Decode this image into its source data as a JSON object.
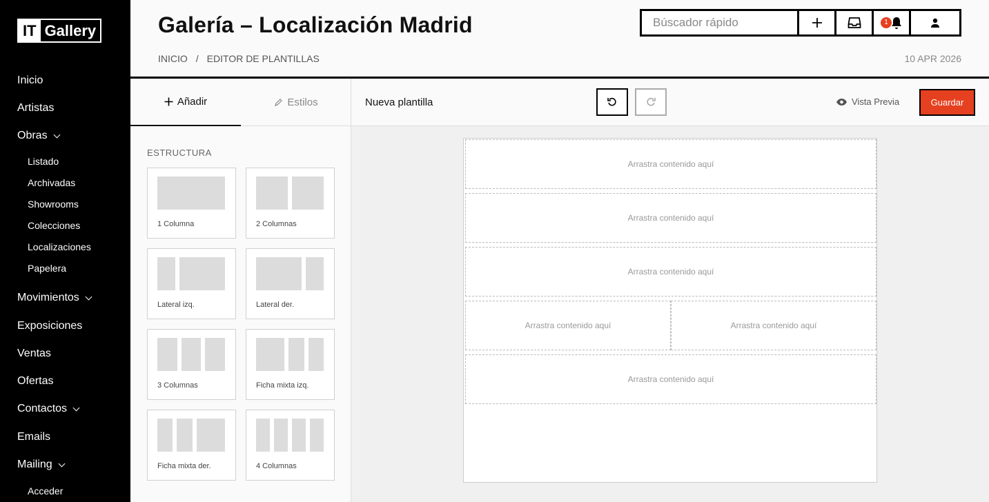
{
  "logo": {
    "left": "IT",
    "right": "Gallery"
  },
  "sidebar": {
    "items": [
      {
        "label": "Inicio"
      },
      {
        "label": "Artistas"
      },
      {
        "label": "Obras"
      },
      {
        "label": "Movimientos"
      },
      {
        "label": "Exposiciones"
      },
      {
        "label": "Ventas"
      },
      {
        "label": "Ofertas"
      },
      {
        "label": "Contactos"
      },
      {
        "label": "Emails"
      },
      {
        "label": "Mailing"
      }
    ],
    "obras_sub": [
      "Listado",
      "Archivadas",
      "Showrooms",
      "Colecciones",
      "Localizaciones",
      "Papelera"
    ],
    "mailing_sub": [
      "Acceder"
    ]
  },
  "header": {
    "title": "Galería – Localización Madrid",
    "breadcrumb": [
      "INICIO",
      "/",
      "EDITOR DE PLANTILLAS"
    ],
    "date": "10 APR 2026",
    "search_placeholder": "Búscador rápido",
    "notification_count": "1"
  },
  "panel": {
    "tab_add": "Añadir",
    "tab_styles": "Estilos",
    "section": "ESTRUCTURA",
    "tiles": [
      {
        "label": "1 Columna"
      },
      {
        "label": "2 Columnas"
      },
      {
        "label": "Lateral izq."
      },
      {
        "label": "Lateral der."
      },
      {
        "label": "3 Columnas"
      },
      {
        "label": "Ficha mixta izq."
      },
      {
        "label": "Ficha mixta der."
      },
      {
        "label": "4 Columnas"
      }
    ]
  },
  "editor": {
    "template_name": "Nueva plantilla",
    "preview_label": "Vista Previa",
    "save_label": "Guardar",
    "drop_text": "Arrastra contenido aquí"
  },
  "colors": {
    "accent": "#e5401f",
    "sidebar": "#000000"
  }
}
